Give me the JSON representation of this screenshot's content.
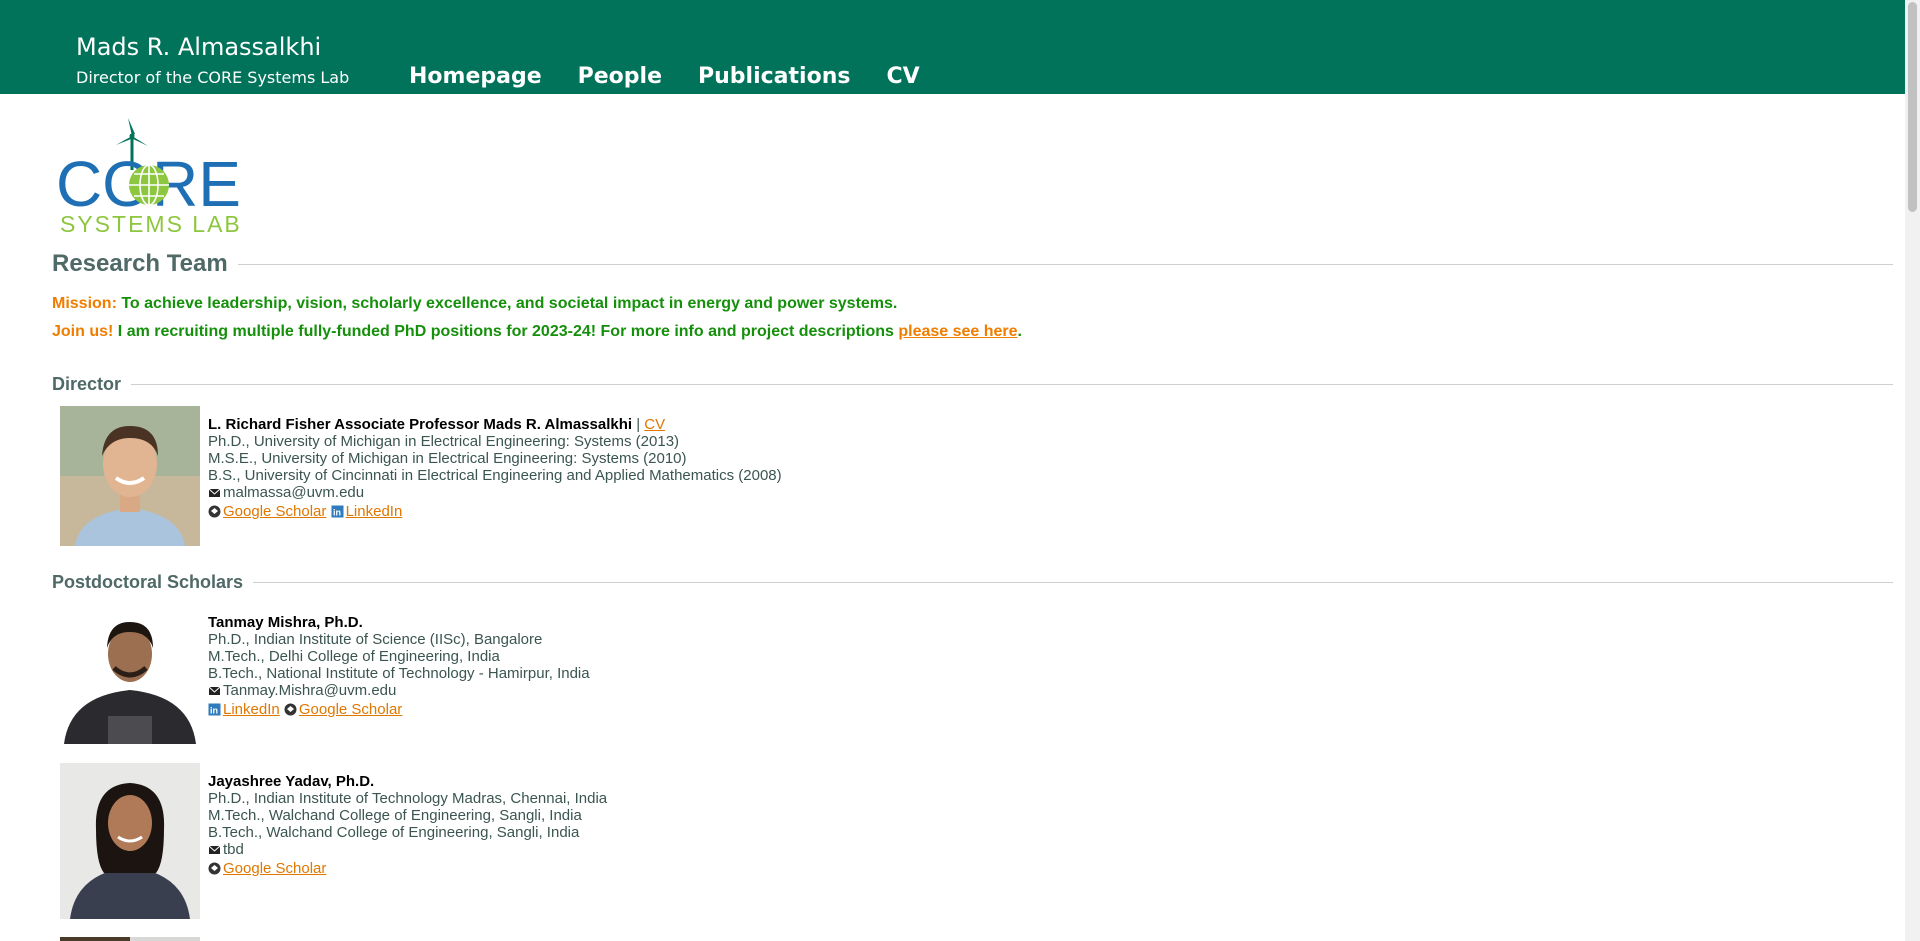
{
  "header": {
    "site_name": "Mads R. Almassalkhi",
    "subtitle": "Director of the CORE Systems Lab",
    "nav": [
      "Homepage",
      "People",
      "Publications",
      "CV"
    ]
  },
  "logo": {
    "word_top": "CORE",
    "word_bottom": "SYSTEMS LAB"
  },
  "research_team": {
    "heading": "Research Team",
    "mission_key": "Mission:",
    "mission_text": "To achieve leadership, vision, scholarly excellence, and societal impact in energy and power systems.",
    "join_key": "Join us!",
    "join_text": "I am recruiting multiple fully-funded PhD positions for 2023-24! For more info and project descriptions",
    "join_link": "please see here",
    "join_end": "."
  },
  "director": {
    "heading": "Director",
    "name": "L. Richard Fisher Associate Professor Mads R. Almassalkhi",
    "sep": "|",
    "cv_link": "CV",
    "degrees": [
      "Ph.D., University of Michigan in Electrical Engineering: Systems (2013)",
      "M.S.E., University of Michigan in Electrical Engineering: Systems (2010)",
      "B.S., University of Cincinnati in Electrical Engineering and Applied Mathematics (2008)"
    ],
    "email": "malmassa@uvm.edu",
    "links": [
      "Google Scholar",
      "LinkedIn"
    ]
  },
  "postdocs": {
    "heading": "Postdoctoral Scholars",
    "people": [
      {
        "name": "Tanmay Mishra, Ph.D.",
        "degrees": [
          "Ph.D., Indian Institute of Science (IISc), Bangalore",
          "M.Tech., Delhi College of Engineering, India",
          "B.Tech., National Institute of Technology - Hamirpur, India"
        ],
        "email": "Tanmay.Mishra@uvm.edu",
        "links": [
          "LinkedIn",
          "Google Scholar"
        ]
      },
      {
        "name": "Jayashree Yadav, Ph.D.",
        "degrees": [
          "Ph.D., Indian Institute of Technology Madras, Chennai, India",
          "M.Tech., Walchand College of Engineering, Sangli, India",
          "B.Tech., Walchand College of Engineering, Sangli, India"
        ],
        "email": "tbd",
        "links": [
          "Google Scholar"
        ]
      }
    ]
  },
  "colors": {
    "header_bg": "#00735a",
    "accent_orange": "#f07d00",
    "mission_green": "#15900b",
    "heading_gray": "#4f6966"
  },
  "icons": [
    "envelope-icon",
    "google-scholar-icon",
    "linkedin-icon"
  ]
}
